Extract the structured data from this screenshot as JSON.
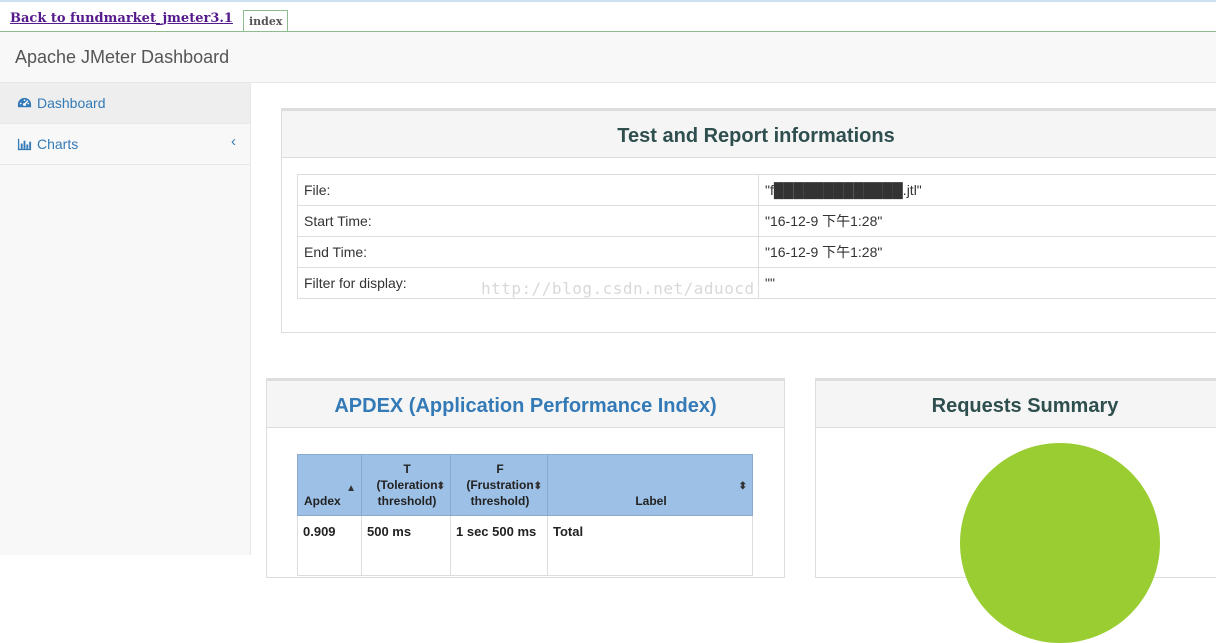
{
  "topbar": {
    "back_link": "Back to fundmarket_jmeter3.1",
    "tab": "index"
  },
  "navbar": {
    "brand": "Apache JMeter Dashboard"
  },
  "sidebar": {
    "items": [
      {
        "label": "Dashboard",
        "icon": "dashboard-icon",
        "active": true
      },
      {
        "label": "Charts",
        "icon": "bar-chart-icon",
        "expander": "‹"
      }
    ]
  },
  "report_info": {
    "title": "Test and Report informations",
    "rows": [
      {
        "key": "File:",
        "value": "\"f█████████████.jtl\""
      },
      {
        "key": "Start Time:",
        "value": "\"16-12-9 下午1:28\""
      },
      {
        "key": "End Time:",
        "value": "\"16-12-9 下午1:28\""
      },
      {
        "key": "Filter for display:",
        "value": "\"\""
      }
    ]
  },
  "watermark": "http://blog.csdn.net/aduocd",
  "apdex": {
    "title": "APDEX (Application Performance Index)",
    "headers": {
      "apdex": "Apdex",
      "t_line1": "T",
      "t_line2": "(Toleration",
      "t_line3": "threshold)",
      "f_line1": "F",
      "f_line2": "(Frustration",
      "f_line3": "threshold)",
      "label": "Label"
    },
    "rows": [
      {
        "apdex": "0.909",
        "t": "500 ms",
        "f": "1 sec 500 ms",
        "label": "Total"
      }
    ]
  },
  "requests_summary": {
    "title": "Requests Summary",
    "pie_color": "#9acd32"
  }
}
